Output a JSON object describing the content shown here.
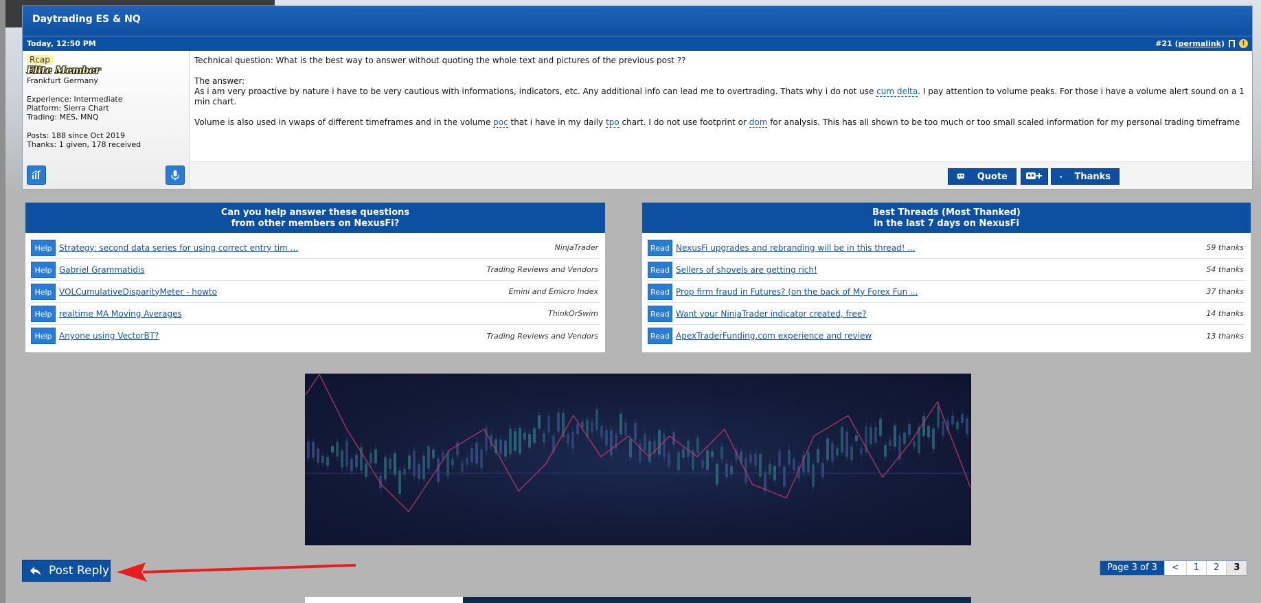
{
  "post": {
    "thread_title": "Daytrading ES & NQ",
    "date": "Today, 12:50 PM",
    "number": "#21",
    "permalink_label": "permalink",
    "user": {
      "name": "Rcap",
      "title": "Elite Member",
      "location": "Frankfurt Germany",
      "experience": "Experience: Intermediate",
      "platform": "Platform: Sierra Chart",
      "trading": "Trading: MES, MNQ",
      "posts": "Posts: 188 since Oct 2019",
      "thanks": "Thanks: 1 given, 178 received"
    },
    "body": {
      "p1": "Technical question: What is the best way to answer without quoting the whole text and pictures of the previous post ??",
      "p2a": "The answer:",
      "p2b": "As i am very proactive by nature i have to be very cautious with informations, indicators, etc. Any additional info can lead me to overtrading. Thats why i do not use ",
      "kw_cum_delta": "cum delta",
      "p2c": ". I pay attention to volume peaks. For those i have a volume alert sound on a 1 min chart.",
      "p3a": "Volume is also used in vwaps of different timeframes and in the volume ",
      "kw_poc": "poc",
      "p3b": " that i have in my daily ",
      "kw_tpo": "tpo",
      "p3c": " chart. I do not use footprint or ",
      "kw_dom": "dom",
      "p3d": " for analysis. This has all shown to be too much or too small scaled information for my personal trading timeframe"
    },
    "actions": {
      "quote": "Quote",
      "thanks": "Thanks"
    }
  },
  "help_box": {
    "title_line1": "Can you help answer these questions",
    "title_line2": "from other members on NexusFi?",
    "badge": "Help",
    "items": [
      {
        "title": "Strategy: second data series for using correct entry tim ...",
        "category": "NinjaTrader"
      },
      {
        "title": "Gabriel Grammatidis",
        "category": "Trading Reviews and Vendors"
      },
      {
        "title": "VOLCumulativeDisparityMeter - howto",
        "category": "Emini and Emicro Index"
      },
      {
        "title": "realtime MA Moving Averages",
        "category": "ThinkOrSwim"
      },
      {
        "title": "Anyone using VectorBT?",
        "category": "Trading Reviews and Vendors"
      }
    ]
  },
  "best_box": {
    "title_line1": "Best Threads (Most Thanked)",
    "title_line2": "in the last 7 days on NexusFi",
    "badge": "Read",
    "items": [
      {
        "title": "NexusFi upgrades and rebranding will be in this thread! ...",
        "count": "59 thanks"
      },
      {
        "title": "Sellers of shovels are getting rich!",
        "count": "54 thanks"
      },
      {
        "title": "Prop firm fraud in Futures? (on the back of My Forex Fun ...",
        "count": "37 thanks"
      },
      {
        "title": "Want your NinjaTrader indicator created, free?",
        "count": "14 thanks"
      },
      {
        "title": "ApexTraderFunding.com experience and review",
        "count": "13 thanks"
      }
    ]
  },
  "reply_button": "Post Reply",
  "pager": {
    "label": "Page 3 of 3",
    "prev": "<",
    "pages": [
      "1",
      "2",
      "3"
    ]
  },
  "colors": {
    "header_blue": "#0d4fa0",
    "badge_blue": "#2a7bd6",
    "arrow_red": "#e61e1e"
  }
}
